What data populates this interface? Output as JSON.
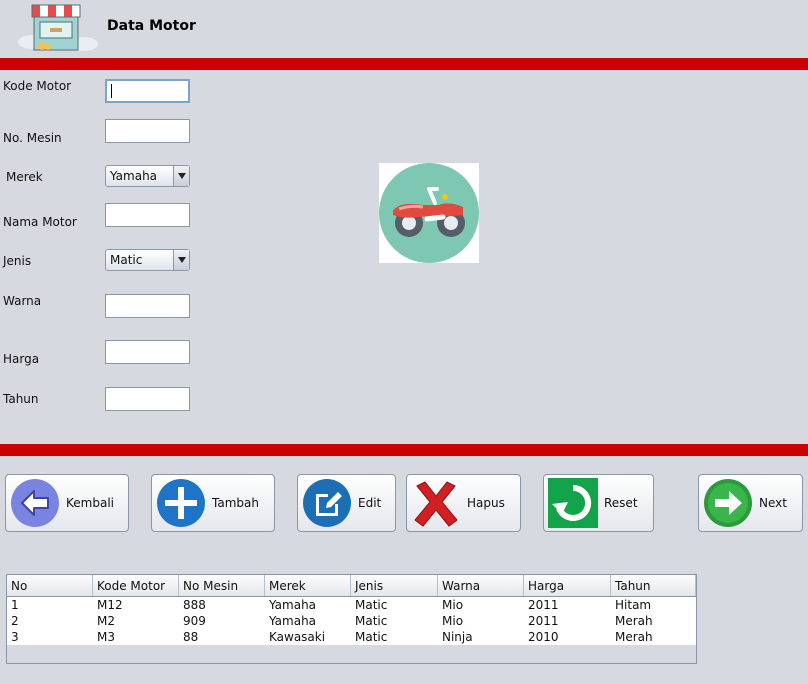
{
  "header": {
    "title": "Data Motor",
    "logo_icon": "store-front-icon"
  },
  "colors": {
    "accent_bar": "#cc0000",
    "background": "#d6d9df"
  },
  "form": {
    "kode_motor": {
      "label": "Kode Motor",
      "value": ""
    },
    "no_mesin": {
      "label": "No. Mesin",
      "value": ""
    },
    "merek": {
      "label": "Merek",
      "selected": "Yamaha"
    },
    "nama_motor": {
      "label": "Nama Motor",
      "value": ""
    },
    "jenis": {
      "label": "Jenis",
      "selected": "Matic"
    },
    "warna": {
      "label": "Warna",
      "value": ""
    },
    "harga": {
      "label": "Harga",
      "value": ""
    },
    "tahun": {
      "label": "Tahun",
      "value": ""
    }
  },
  "illustration": {
    "icon": "motorcycle-icon"
  },
  "buttons": {
    "kembali": {
      "label": "Kembali",
      "icon": "back-arrow-icon"
    },
    "tambah": {
      "label": "Tambah",
      "icon": "plus-icon"
    },
    "edit": {
      "label": "Edit",
      "icon": "edit-icon"
    },
    "hapus": {
      "label": "Hapus",
      "icon": "delete-x-icon"
    },
    "reset": {
      "label": "Reset",
      "icon": "reset-icon"
    },
    "next": {
      "label": "Next",
      "icon": "next-arrow-icon"
    }
  },
  "table": {
    "columns": [
      "No",
      "Kode Motor",
      "No Mesin",
      "Merek",
      "Jenis",
      "Warna",
      "Harga",
      "Tahun"
    ],
    "rows": [
      [
        "1",
        "M12",
        "888",
        "Yamaha",
        "Matic",
        "Mio",
        "2011",
        "Hitam"
      ],
      [
        "2",
        "M2",
        "909",
        "Yamaha",
        "Matic",
        "Mio",
        "2011",
        "Merah"
      ],
      [
        "3",
        "M3",
        "88",
        "Kawasaki",
        "Matic",
        "Ninja",
        "2010",
        "Merah"
      ]
    ]
  }
}
